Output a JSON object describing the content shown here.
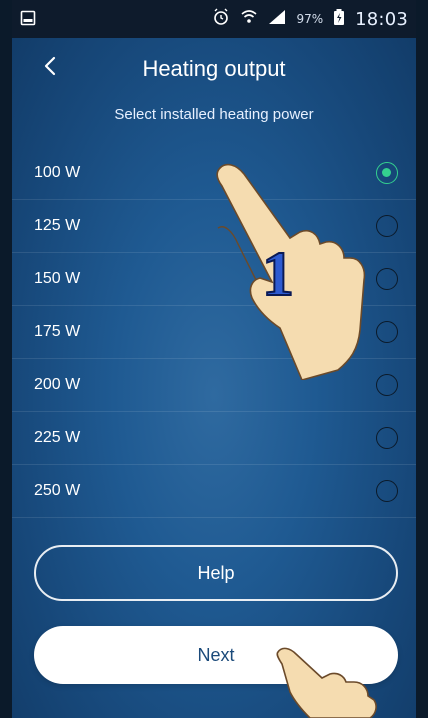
{
  "status_bar": {
    "battery_percent": "97%",
    "time": "18:03",
    "icons": [
      "screen-icon",
      "alarm-icon",
      "wifi-icon",
      "signal-icon",
      "battery-icon"
    ]
  },
  "header": {
    "title": "Heating output",
    "back_icon": "chevron-left-icon"
  },
  "subtitle": "Select installed heating power",
  "options": [
    {
      "label": "100 W",
      "selected": true
    },
    {
      "label": "125 W",
      "selected": false
    },
    {
      "label": "150 W",
      "selected": false
    },
    {
      "label": "175 W",
      "selected": false
    },
    {
      "label": "200 W",
      "selected": false
    },
    {
      "label": "225 W",
      "selected": false
    },
    {
      "label": "250 W",
      "selected": false
    }
  ],
  "buttons": {
    "help_label": "Help",
    "next_label": "Next"
  },
  "annotation": {
    "step_number": "1"
  },
  "colors": {
    "accent_selected": "#34d08f",
    "background": "#1f5a92",
    "next_text": "#1b4a7a"
  }
}
